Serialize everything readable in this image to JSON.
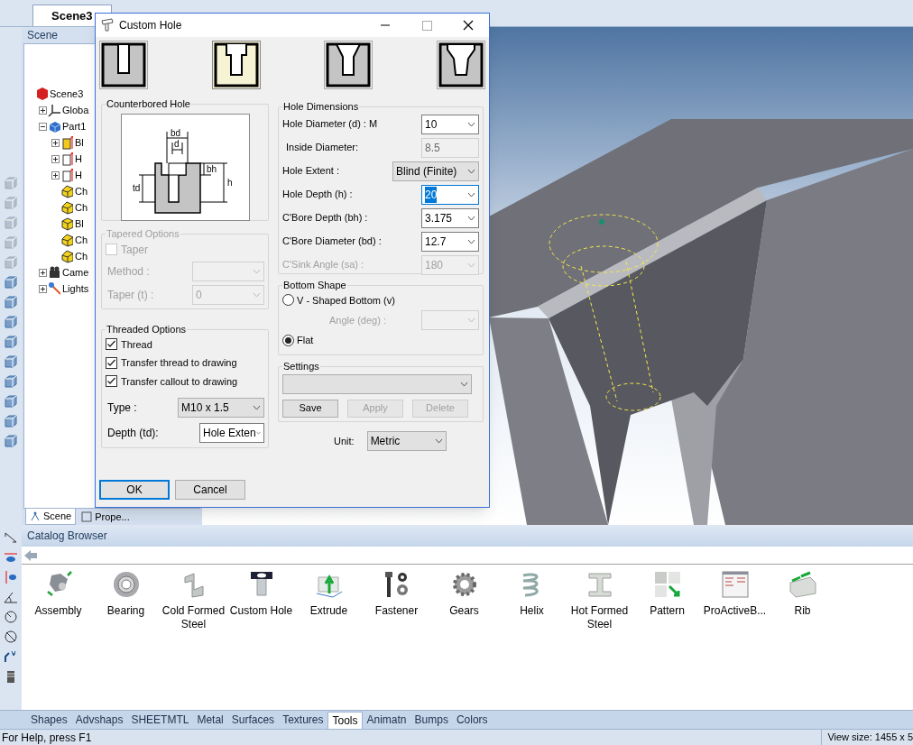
{
  "doc_tab": {
    "label": "Scene3"
  },
  "scene_panel": {
    "title": "Scene",
    "tree": [
      {
        "label": "Scene3",
        "kind": "scene",
        "children": [
          {
            "label": "Globa",
            "kind": "axes",
            "expanded": false
          },
          {
            "label": "Part1",
            "kind": "part",
            "expanded": true,
            "children": [
              {
                "label": "Bl",
                "kind": "block",
                "expanded": false
              },
              {
                "label": "H",
                "kind": "hole",
                "expanded": false
              },
              {
                "label": "H",
                "kind": "hole",
                "expanded": false
              },
              {
                "label": "Ch",
                "kind": "chamfer"
              },
              {
                "label": "Ch",
                "kind": "chamfer"
              },
              {
                "label": "Bl",
                "kind": "blockface"
              },
              {
                "label": "Ch",
                "kind": "chamfer"
              },
              {
                "label": "Ch",
                "kind": "chamfer"
              }
            ]
          },
          {
            "label": "Came",
            "kind": "camera",
            "expanded": false
          },
          {
            "label": "Lights",
            "kind": "light",
            "expanded": false
          }
        ]
      }
    ],
    "tabs": [
      {
        "label": "Scene",
        "selected": true
      },
      {
        "label": "Prope...",
        "selected": false
      }
    ]
  },
  "dialog": {
    "title": "Custom Hole",
    "hole_types": [
      {
        "kind": "simple",
        "selected": false
      },
      {
        "kind": "counterbore",
        "selected": true
      },
      {
        "kind": "countersink",
        "selected": false
      },
      {
        "kind": "combined",
        "selected": false
      }
    ],
    "preview": {
      "title": "Counterbored Hole",
      "labels": [
        "bd",
        "d",
        "bh",
        "h",
        "td"
      ]
    },
    "tapered": {
      "title": "Tapered Options",
      "disabled": true,
      "taper": {
        "label": "Taper",
        "checked": false
      },
      "fields": [
        {
          "label": "Method :"
        },
        {
          "label": "Taper (t) :",
          "value": "0"
        }
      ]
    },
    "threaded": {
      "title": "Threaded Options",
      "checks": [
        {
          "label": "Thread",
          "checked": true
        },
        {
          "label": "Transfer thread to drawing",
          "checked": true
        },
        {
          "label": "Transfer callout to drawing",
          "checked": true
        }
      ],
      "fields": [
        {
          "label": "Type :",
          "value": "M10 x 1.5",
          "kind": "list"
        },
        {
          "label": "Depth (td):",
          "value": "Hole Exten",
          "kind": "combo"
        }
      ]
    },
    "dimensions": {
      "title": "Hole Dimensions",
      "rows": [
        {
          "label": "Hole Diameter (d) : M",
          "value": "10",
          "kind": "combo",
          "disabled": false,
          "focused": false
        },
        {
          "label": "Inside Diameter:",
          "value": "8.5",
          "kind": "readonly",
          "disabled": false,
          "focused": false
        },
        {
          "label": "Hole Extent :",
          "value": "Blind (Finite)",
          "kind": "list",
          "disabled": false,
          "focused": false
        },
        {
          "label": "Hole Depth (h) :",
          "value": "20",
          "kind": "combo",
          "disabled": false,
          "focused": true
        },
        {
          "label": "C'Bore Depth (bh) :",
          "value": "3.175",
          "kind": "combo",
          "disabled": false,
          "focused": false
        },
        {
          "label": "C'Bore Diameter (bd) :",
          "value": "12.7",
          "kind": "combo",
          "disabled": false,
          "focused": false
        },
        {
          "label": "C'Sink Angle (sa) :",
          "value": "180",
          "kind": "combo",
          "disabled": true,
          "focused": false
        }
      ]
    },
    "bottom_shape": {
      "title": "Bottom Shape",
      "options": [
        {
          "label": "V - Shaped Bottom (v)",
          "selected": false
        },
        {
          "label": "Flat",
          "selected": true
        }
      ],
      "angle": {
        "label": "Angle (deg) :",
        "disabled": true
      }
    },
    "settings": {
      "title": "Settings",
      "buttons": [
        {
          "label": "Save",
          "disabled": false
        },
        {
          "label": "Apply",
          "disabled": true
        },
        {
          "label": "Delete",
          "disabled": true
        }
      ]
    },
    "unit": {
      "label": "Unit:",
      "value": "Metric"
    },
    "buttons": [
      {
        "label": "OK",
        "default": true
      },
      {
        "label": "Cancel",
        "default": false
      }
    ]
  },
  "catalog": {
    "title": "Catalog Browser",
    "items": [
      {
        "label": "Assembly",
        "kind": "assembly"
      },
      {
        "label": "Bearing",
        "kind": "bearing"
      },
      {
        "label": "Cold Formed Steel",
        "kind": "cold"
      },
      {
        "label": "Custom Hole",
        "kind": "hole"
      },
      {
        "label": "Extrude",
        "kind": "extrude"
      },
      {
        "label": "Fastener",
        "kind": "fastener"
      },
      {
        "label": "Gears",
        "kind": "gear"
      },
      {
        "label": "Helix",
        "kind": "helix"
      },
      {
        "label": "Hot Formed Steel",
        "kind": "beam"
      },
      {
        "label": "Pattern",
        "kind": "pattern"
      },
      {
        "label": "ProActiveB...",
        "kind": "window"
      },
      {
        "label": "Rib",
        "kind": "rib"
      }
    ]
  },
  "bottom_tabs": [
    {
      "label": "Shapes",
      "selected": false
    },
    {
      "label": "Advshaps",
      "selected": false
    },
    {
      "label": "SHEETMTL",
      "selected": false
    },
    {
      "label": "Metal",
      "selected": false
    },
    {
      "label": "Surfaces",
      "selected": false
    },
    {
      "label": "Textures",
      "selected": false
    },
    {
      "label": "Tools",
      "selected": true
    },
    {
      "label": "Animatn",
      "selected": false
    },
    {
      "label": "Bumps",
      "selected": false
    },
    {
      "label": "Colors",
      "selected": false
    }
  ],
  "status_bar": {
    "help": "For Help, press F1",
    "view_size": "View size: 1455 x 5"
  }
}
